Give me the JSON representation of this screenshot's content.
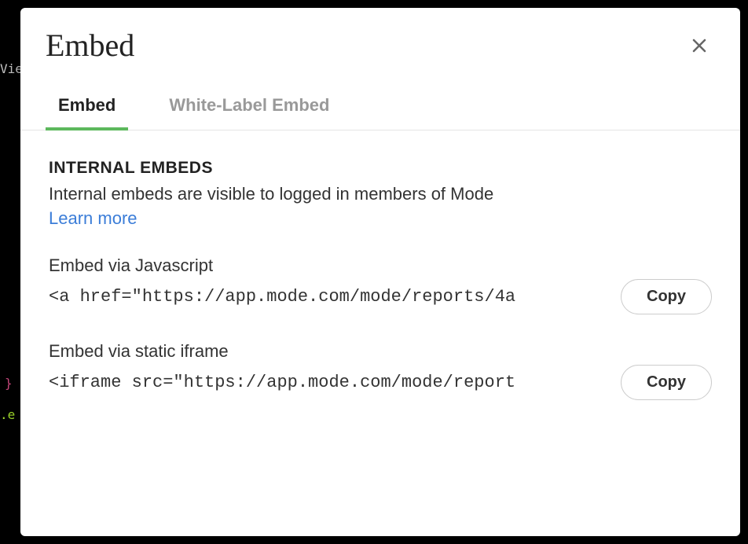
{
  "modal": {
    "title": "Embed",
    "tabs": [
      {
        "label": "Embed",
        "active": true
      },
      {
        "label": "White-Label Embed",
        "active": false
      }
    ]
  },
  "section": {
    "title": "INTERNAL EMBEDS",
    "description": "Internal embeds are visible to logged in members of Mode",
    "learn_more": "Learn more"
  },
  "embeds": [
    {
      "label": "Embed via Javascript",
      "code": "<a href=\"https://app.mode.com/mode/reports/4a",
      "copy_label": "Copy"
    },
    {
      "label": "Embed via static iframe",
      "code": "<iframe src=\"https://app.mode.com/mode/report",
      "copy_label": "Copy"
    }
  ],
  "background": {
    "text1": "Vie",
    "text2": "}",
    "text3": ".e"
  }
}
